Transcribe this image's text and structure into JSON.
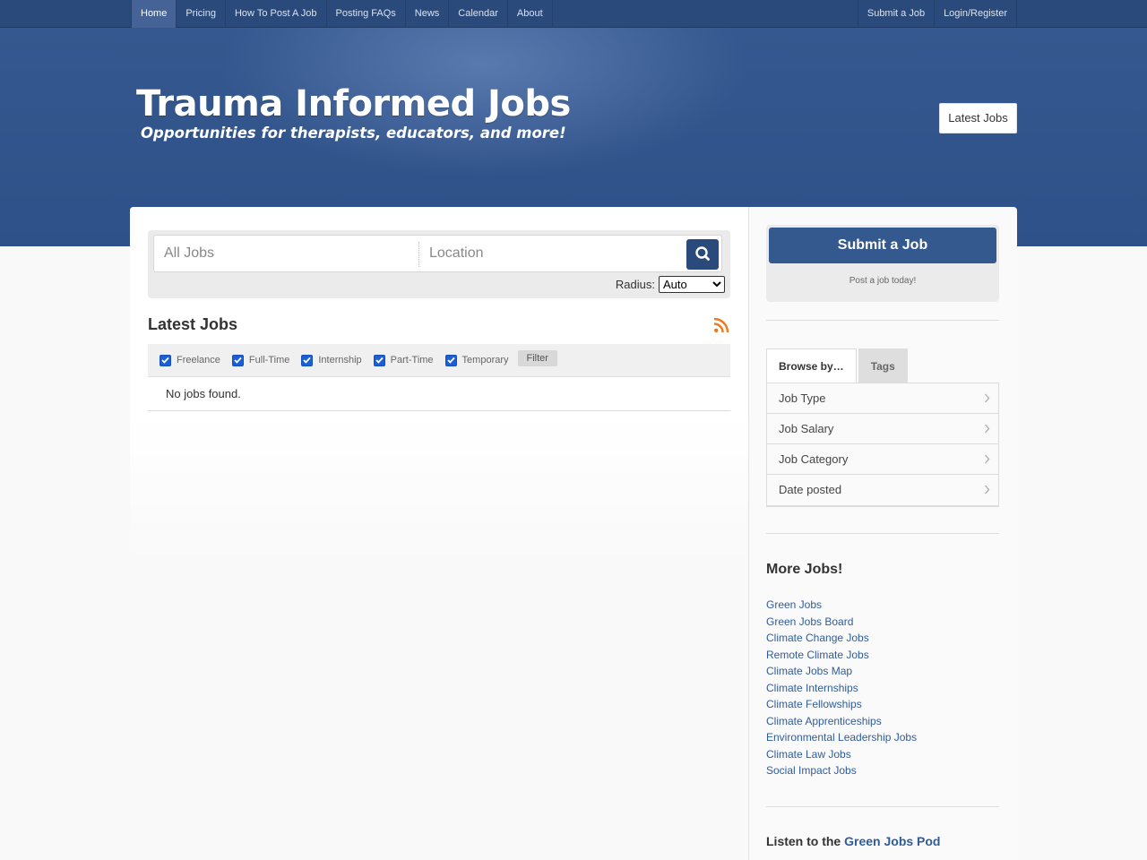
{
  "nav": {
    "left": [
      {
        "label": "Home",
        "active": true
      },
      {
        "label": "Pricing"
      },
      {
        "label": "How To Post A Job"
      },
      {
        "label": "Posting FAQs"
      },
      {
        "label": "News"
      },
      {
        "label": "Calendar"
      },
      {
        "label": "About"
      }
    ],
    "right": [
      {
        "label": "Submit a Job"
      },
      {
        "label": "Login/Register"
      }
    ]
  },
  "header": {
    "title": "Trauma Informed Jobs",
    "tagline": "Opportunities for therapists, educators, and more!",
    "latest_button": "Latest Jobs"
  },
  "search": {
    "keywords_placeholder": "All Jobs",
    "location_placeholder": "Location",
    "radius_label": "Radius:",
    "radius_selected": "Auto",
    "search_icon": "search-icon"
  },
  "jobs": {
    "heading": "Latest Jobs",
    "rss_icon": "rss-icon",
    "filters": [
      {
        "label": "Freelance",
        "checked": true
      },
      {
        "label": "Full-Time",
        "checked": true
      },
      {
        "label": "Internship",
        "checked": true
      },
      {
        "label": "Part-Time",
        "checked": true
      },
      {
        "label": "Temporary",
        "checked": true
      }
    ],
    "filter_button": "Filter",
    "empty_message": "No jobs found."
  },
  "sidebar": {
    "submit_button": "Submit a Job",
    "submit_sub": "Post a job today!",
    "tabs": [
      "Browse by…",
      "Tags"
    ],
    "browse_items": [
      "Job Type",
      "Job Salary",
      "Job Category",
      "Date posted"
    ],
    "more_heading": "More Jobs!",
    "more_links": [
      "Green Jobs",
      "Green Jobs Board",
      "Climate Change Jobs",
      "Remote Climate Jobs",
      "Climate Jobs Map",
      "Climate Internships",
      "Climate Fellowships",
      "Climate Apprenticeships",
      "Environmental Leadership Jobs",
      "Climate Law Jobs",
      "Social Impact Jobs"
    ],
    "listen_prefix": "Listen to the",
    "listen_link": "Green Jobs Pod"
  },
  "colors": {
    "nav_bg": "#2b4a7c",
    "header_bg": "#2f5189",
    "accent": "#34598f",
    "link": "#2f5c9a",
    "rss": "#f0781e"
  }
}
